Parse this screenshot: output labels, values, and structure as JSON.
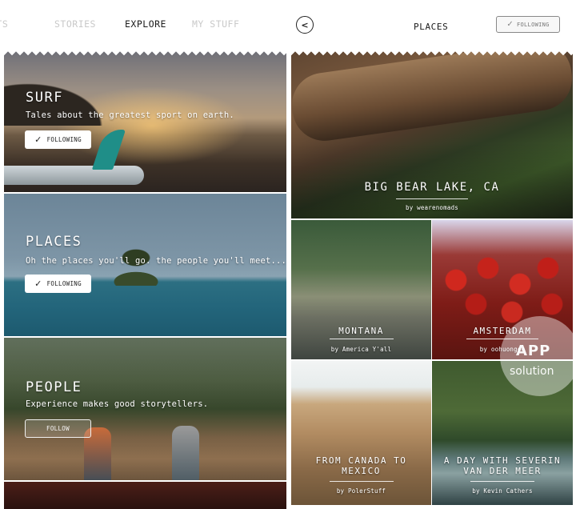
{
  "left": {
    "tabs": [
      {
        "label": "OTS"
      },
      {
        "label": "STORIES"
      },
      {
        "label": "EXPLORE",
        "active": true
      },
      {
        "label": "MY STUFF"
      }
    ],
    "cards": {
      "surf": {
        "title": "SURF",
        "description": "Tales about the greatest sport on earth.",
        "button": "FOLLOWING",
        "following": true
      },
      "places": {
        "title": "PLACES",
        "description": "Oh the places you'll go. the people you'll meet...",
        "button": "FOLLOWING",
        "following": true
      },
      "people": {
        "title": "PEOPLE",
        "description": "Experience makes good storytellers.",
        "button": "FOLLOW",
        "following": false
      }
    }
  },
  "right": {
    "header": {
      "title": "PLACES",
      "button": "FOLLOWING",
      "back_icon": "chevron-left-icon"
    },
    "tiles": {
      "bigbear": {
        "title": "BIG BEAR LAKE, CA",
        "byline": "by wearenomads"
      },
      "montana": {
        "title": "MONTANA",
        "byline": "by America Y'all"
      },
      "amsterdam": {
        "title": "AMSTERDAM",
        "byline": "by oohuongoo"
      },
      "canada": {
        "title_line1": "FROM CANADA TO",
        "title_line2": "MEXICO",
        "byline": "by PolerStuff"
      },
      "severin": {
        "title_line1": "A DAY WITH SEVERIN",
        "title_line2": "VAN DER MEER",
        "byline": "by Kevin Cathers"
      }
    }
  },
  "watermark": {
    "line1": "APP",
    "line2": "solution"
  },
  "colors": {
    "accent_teal": "#1f8e88",
    "text_dark": "#1c1c1c",
    "tab_inactive": "#c9c9c9"
  }
}
